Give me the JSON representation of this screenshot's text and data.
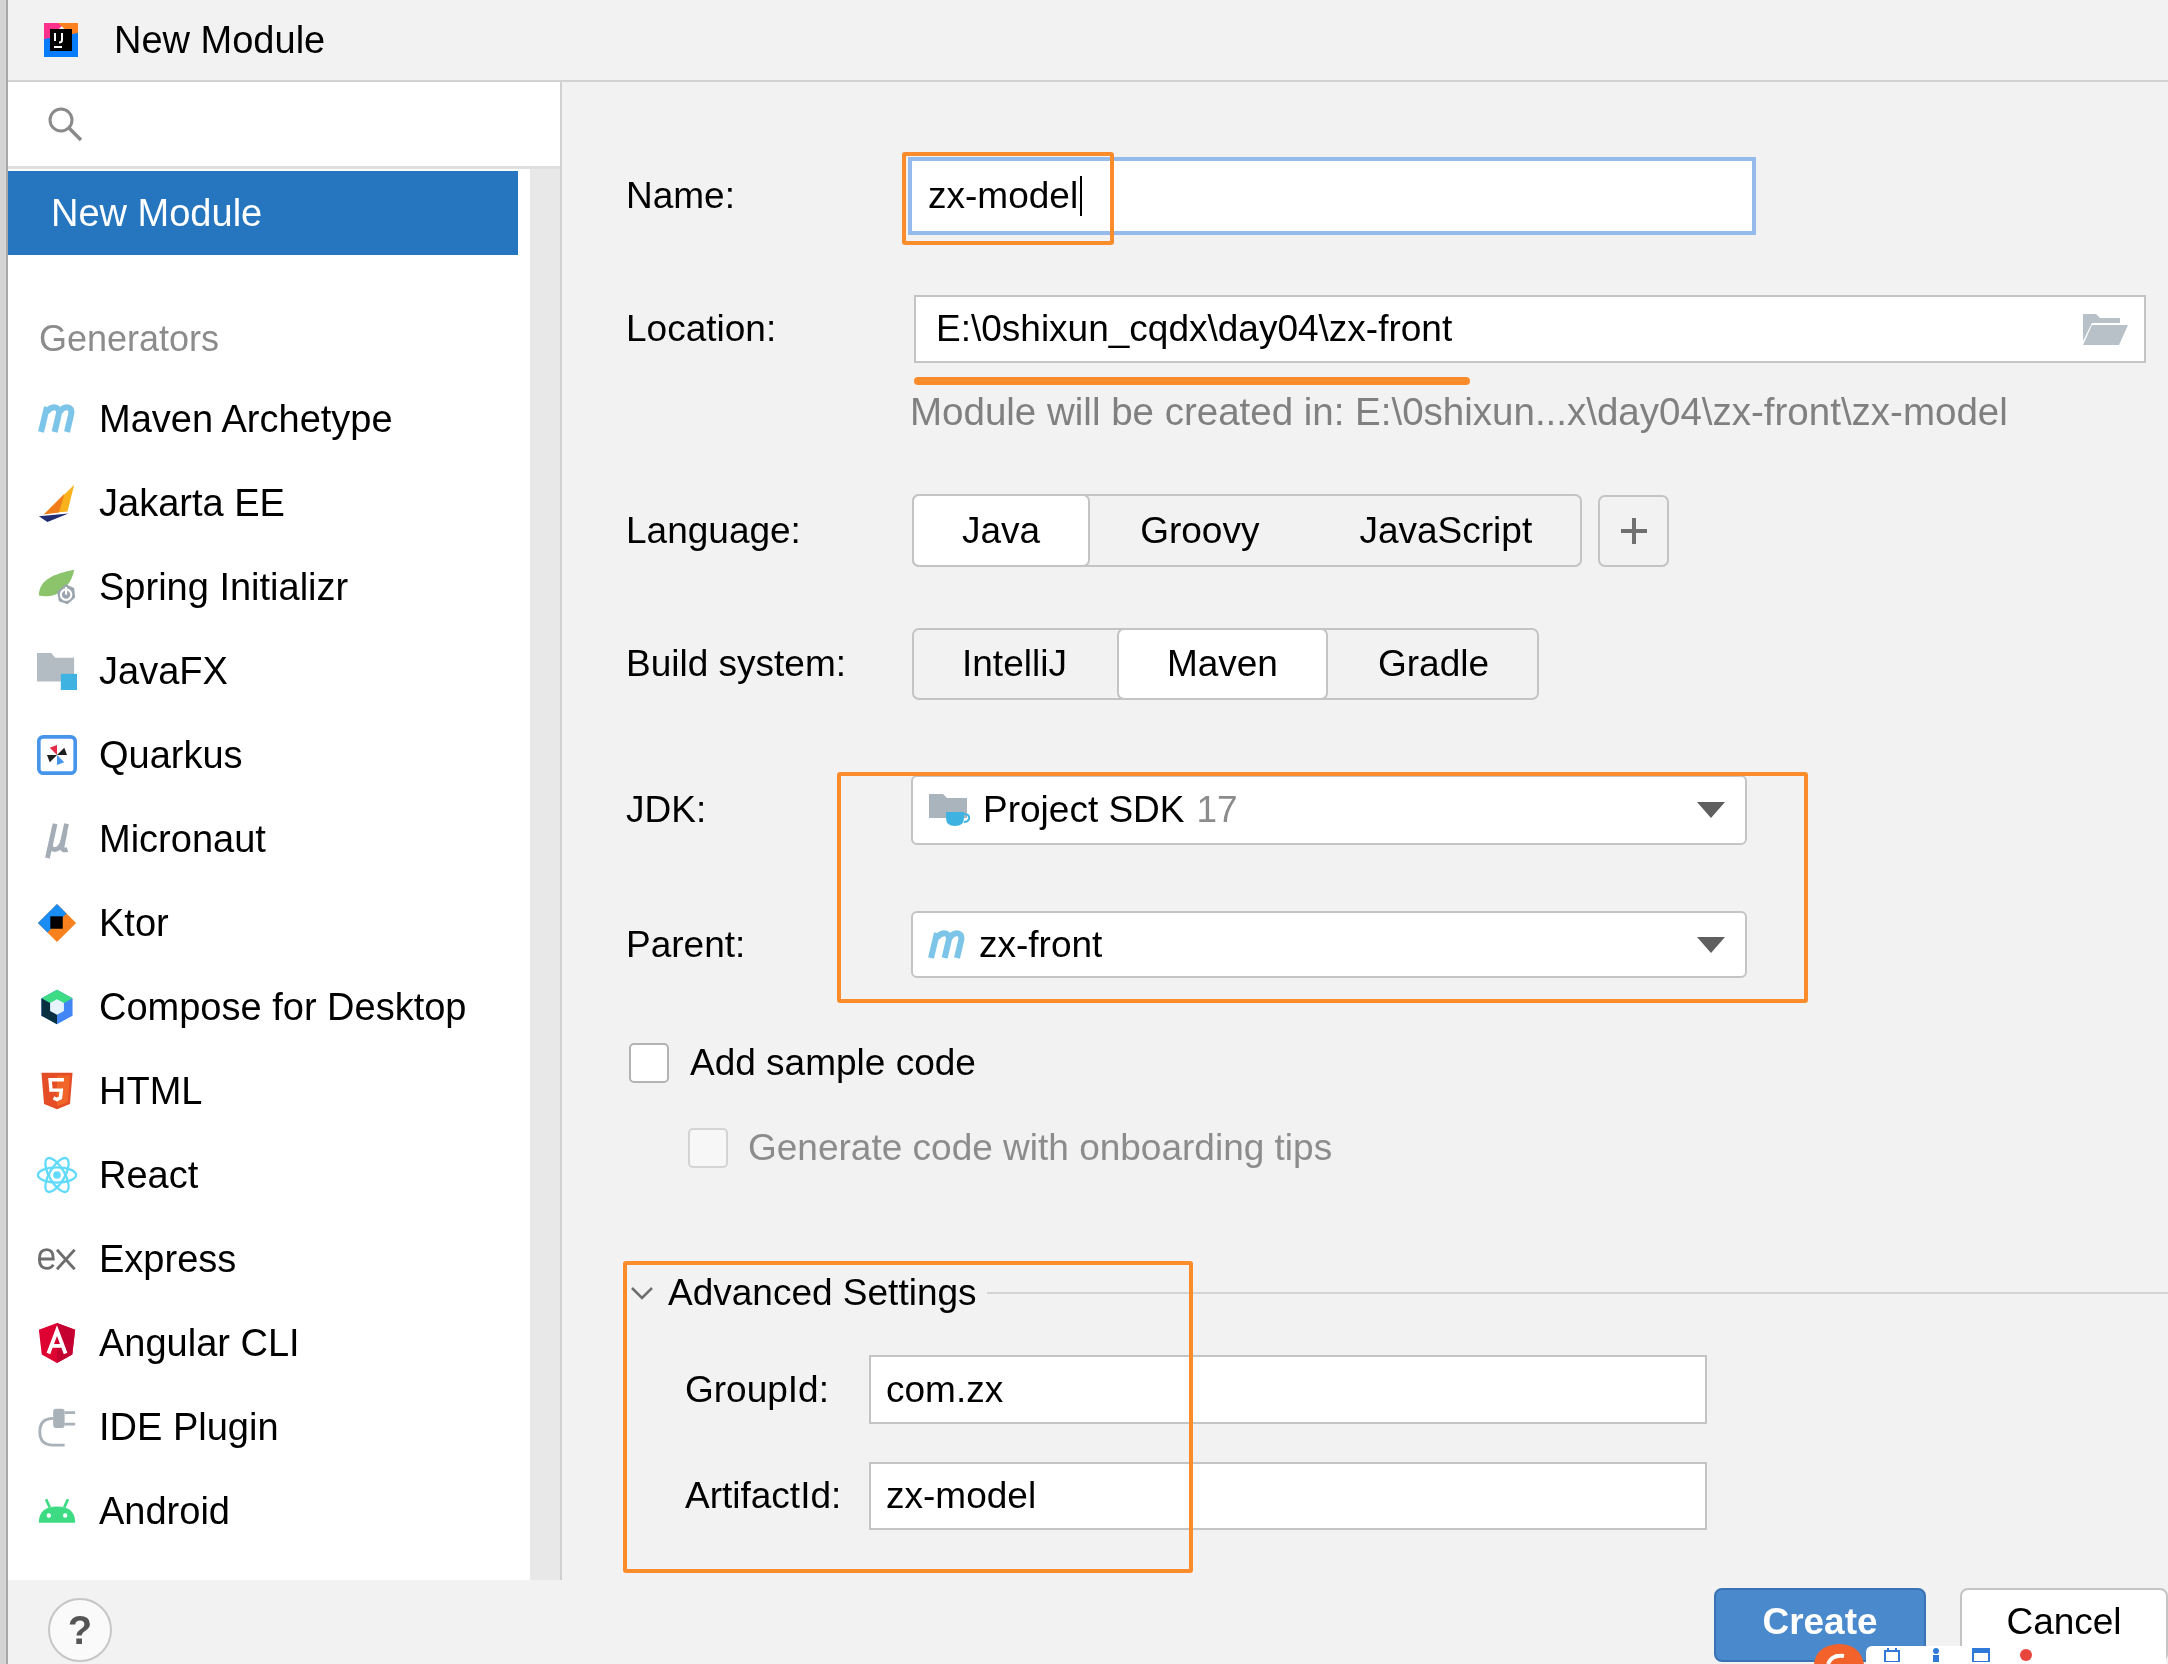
{
  "window": {
    "title": "New Module"
  },
  "sidebar": {
    "items": [
      {
        "label": "New Module",
        "selected": true
      }
    ],
    "sections": [
      {
        "title": "Generators",
        "items": [
          {
            "label": "Maven Archetype",
            "kind": "maven",
            "selected": false
          },
          {
            "label": "Jakarta EE",
            "kind": "jakarta",
            "selected": false
          },
          {
            "label": "Spring Initializr",
            "kind": "spring",
            "selected": false
          },
          {
            "label": "JavaFX",
            "kind": "javafx",
            "selected": false
          },
          {
            "label": "Quarkus",
            "kind": "quarkus",
            "selected": false
          },
          {
            "label": "Micronaut",
            "kind": "micronaut",
            "selected": false
          },
          {
            "label": "Ktor",
            "kind": "ktor",
            "selected": false
          },
          {
            "label": "Compose for Desktop",
            "kind": "compose",
            "selected": false
          },
          {
            "label": "HTML",
            "kind": "html",
            "selected": false
          },
          {
            "label": "React",
            "kind": "react",
            "selected": false
          },
          {
            "label": "Express",
            "kind": "express",
            "selected": false
          },
          {
            "label": "Angular CLI",
            "kind": "angular",
            "selected": false
          },
          {
            "label": "IDE Plugin",
            "kind": "plugin",
            "selected": false
          },
          {
            "label": "Android",
            "kind": "android",
            "selected": false
          }
        ]
      }
    ]
  },
  "form": {
    "name": {
      "label": "Name:",
      "value": "zx-model",
      "focused": true,
      "highlighted": true
    },
    "location": {
      "label": "Location:",
      "value": "E:\\0shixun_cqdx\\day04\\zx-front",
      "underlined": true,
      "hint": "Module will be created in: E:\\0shixun...x\\day04\\zx-front\\zx-model"
    },
    "language": {
      "label": "Language:",
      "options": [
        {
          "label": "Java",
          "selected": true
        },
        {
          "label": "Groovy",
          "selected": false
        },
        {
          "label": "JavaScript",
          "selected": false
        }
      ]
    },
    "build_system": {
      "label": "Build system:",
      "options": [
        {
          "label": "IntelliJ",
          "selected": false
        },
        {
          "label": "Maven",
          "selected": true
        },
        {
          "label": "Gradle",
          "selected": false
        }
      ]
    },
    "sdk_group": {
      "highlighted": true,
      "jdk": {
        "label": "JDK:",
        "value": "Project SDK",
        "version": "17"
      },
      "parent": {
        "label": "Parent:",
        "value": "zx-front"
      }
    },
    "add_sample_code": {
      "label": "Add sample code",
      "checked": false,
      "disabled": false
    },
    "onboarding_tips": {
      "label": "Generate code with onboarding tips",
      "checked": false,
      "disabled": true
    },
    "advanced_settings": {
      "title": "Advanced Settings",
      "expanded": true,
      "highlighted": true,
      "fields": [
        {
          "label": "GroupId:",
          "value": "com.zx"
        },
        {
          "label": "ArtifactId:",
          "value": "zx-model"
        }
      ]
    }
  },
  "footer": {
    "help_button": "?",
    "buttons": [
      {
        "label": "Create",
        "kind": "primary"
      },
      {
        "label": "Cancel",
        "kind": "secondary"
      }
    ]
  }
}
